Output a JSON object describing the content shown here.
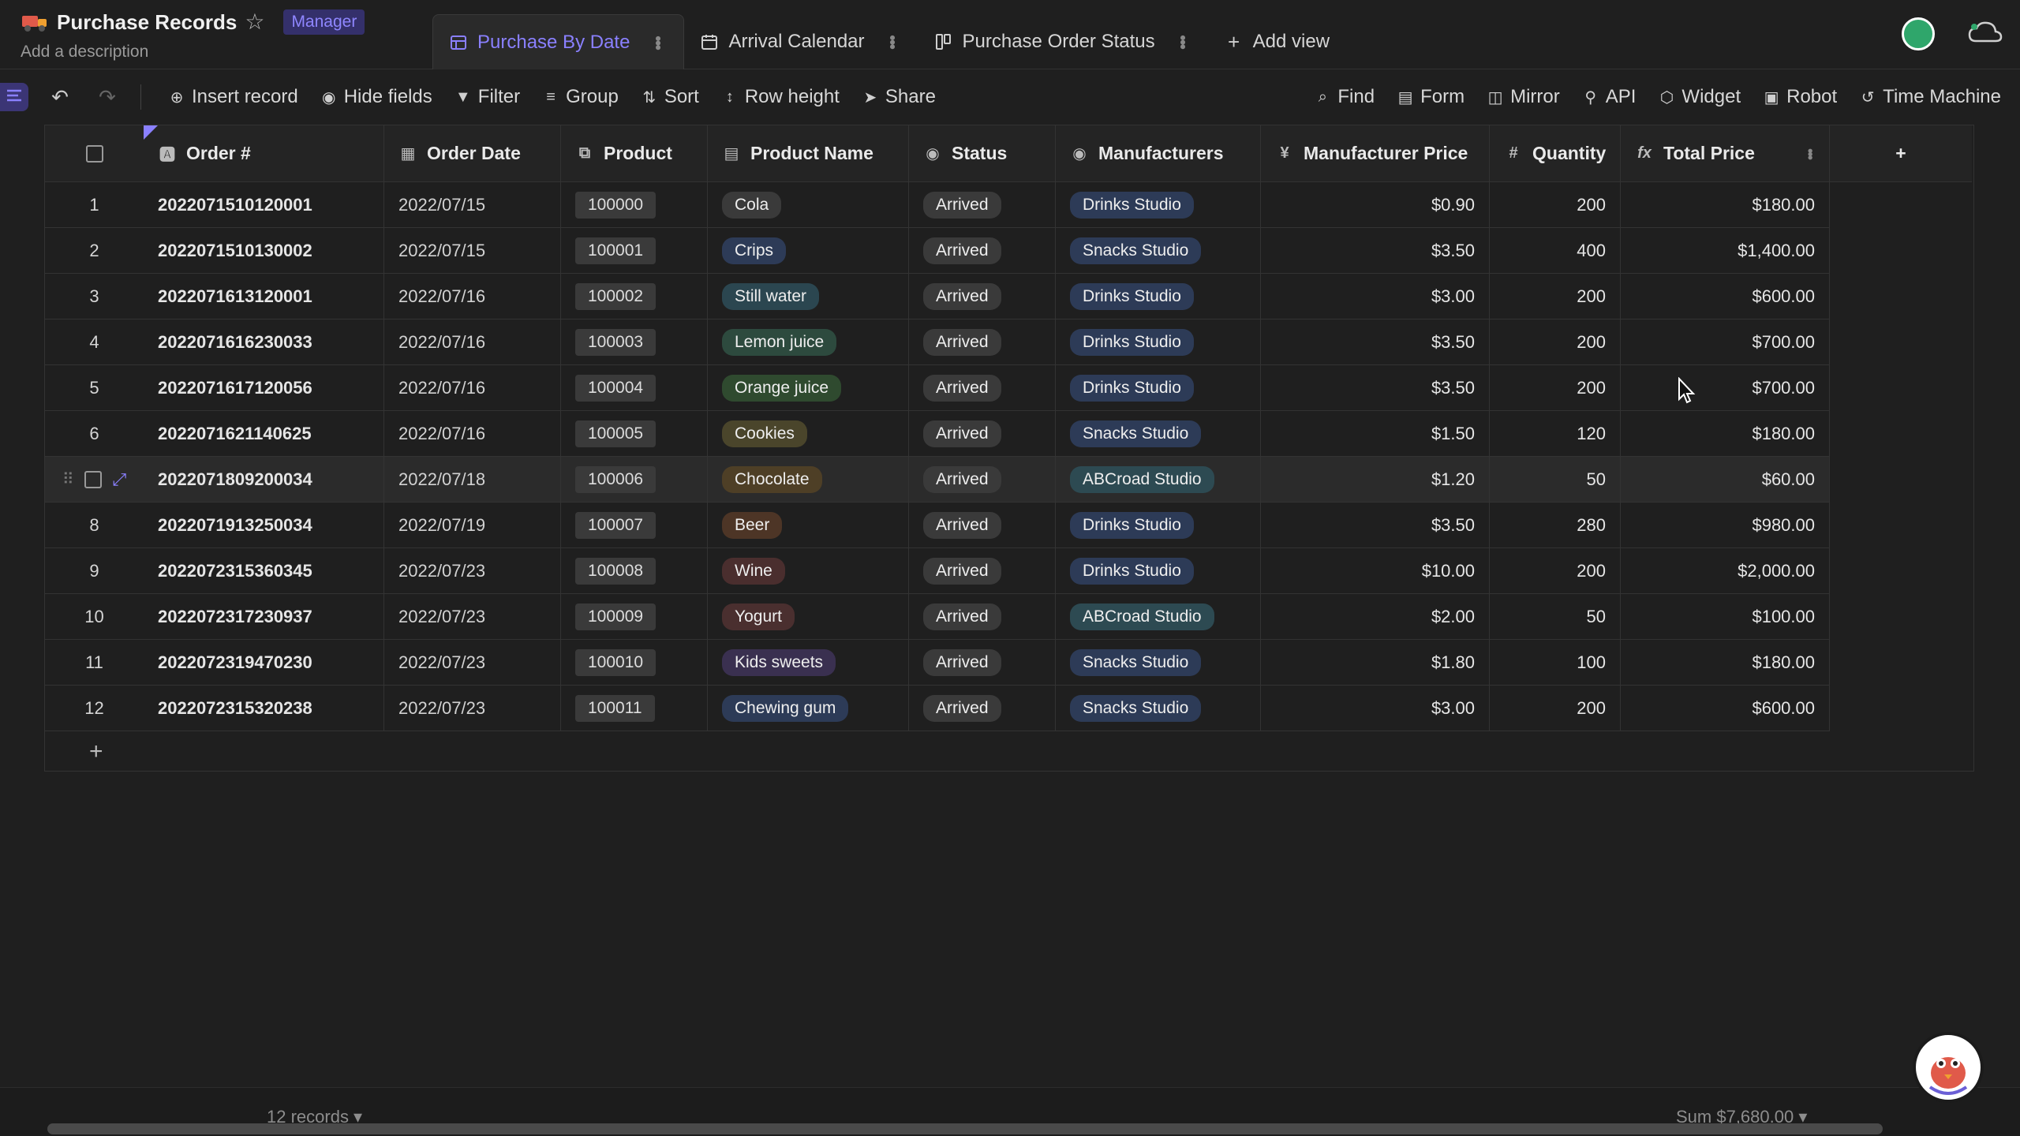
{
  "header": {
    "title": "Purchase Records",
    "role": "Manager",
    "description": "Add a description",
    "tabs": [
      {
        "label": "Purchase By Date",
        "icon": "grid-view-icon",
        "active": true
      },
      {
        "label": "Arrival Calendar",
        "icon": "calendar-icon",
        "active": false
      },
      {
        "label": "Purchase Order Status",
        "icon": "kanban-icon",
        "active": false
      },
      {
        "label": "Add view",
        "icon": "plus-icon",
        "active": false
      }
    ]
  },
  "toolbar": {
    "left": [
      {
        "label": "Insert record",
        "icon": "plus-circle-icon"
      },
      {
        "label": "Hide fields",
        "icon": "eye-icon"
      },
      {
        "label": "Filter",
        "icon": "filter-icon"
      },
      {
        "label": "Group",
        "icon": "group-icon"
      },
      {
        "label": "Sort",
        "icon": "sort-icon"
      },
      {
        "label": "Row height",
        "icon": "row-height-icon"
      },
      {
        "label": "Share",
        "icon": "share-icon"
      }
    ],
    "right": [
      {
        "label": "Find",
        "icon": "search-icon"
      },
      {
        "label": "Form",
        "icon": "form-icon"
      },
      {
        "label": "Mirror",
        "icon": "mirror-icon"
      },
      {
        "label": "API",
        "icon": "api-icon"
      },
      {
        "label": "Widget",
        "icon": "widget-icon"
      },
      {
        "label": "Robot",
        "icon": "robot-icon"
      },
      {
        "label": "Time Machine",
        "icon": "history-icon"
      }
    ]
  },
  "columns": [
    {
      "label": "Order #",
      "icon": "text-field-icon"
    },
    {
      "label": "Order Date",
      "icon": "date-field-icon"
    },
    {
      "label": "Product",
      "icon": "link-field-icon"
    },
    {
      "label": "Product Name",
      "icon": "lookup-field-icon"
    },
    {
      "label": "Status",
      "icon": "select-field-icon"
    },
    {
      "label": "Manufacturers",
      "icon": "select-field-icon"
    },
    {
      "label": "Manufacturer Price",
      "icon": "currency-field-icon"
    },
    {
      "label": "Quantity",
      "icon": "number-field-icon"
    },
    {
      "label": "Total Price",
      "icon": "formula-field-icon"
    }
  ],
  "rows": [
    {
      "idx": "1",
      "order": "2022071510120001",
      "date": "2022/07/15",
      "product": "100000",
      "name": "Cola",
      "status": "Arrived",
      "manufacturer": "Drinks Studio",
      "price": "$0.90",
      "qty": "200",
      "total": "$180.00",
      "name_color": "#3a3a3a"
    },
    {
      "idx": "2",
      "order": "2022071510130002",
      "date": "2022/07/15",
      "product": "100001",
      "name": "Crips",
      "status": "Arrived",
      "manufacturer": "Snacks Studio",
      "price": "$3.50",
      "qty": "400",
      "total": "$1,400.00",
      "name_color": "#2d3b57"
    },
    {
      "idx": "3",
      "order": "2022071613120001",
      "date": "2022/07/16",
      "product": "100002",
      "name": "Still water",
      "status": "Arrived",
      "manufacturer": "Drinks Studio",
      "price": "$3.00",
      "qty": "200",
      "total": "$600.00",
      "name_color": "#2b4650"
    },
    {
      "idx": "4",
      "order": "2022071616230033",
      "date": "2022/07/16",
      "product": "100003",
      "name": "Lemon juice",
      "status": "Arrived",
      "manufacturer": "Drinks Studio",
      "price": "$3.50",
      "qty": "200",
      "total": "$700.00",
      "name_color": "#2d4a3e"
    },
    {
      "idx": "5",
      "order": "2022071617120056",
      "date": "2022/07/16",
      "product": "100004",
      "name": "Orange juice",
      "status": "Arrived",
      "manufacturer": "Drinks Studio",
      "price": "$3.50",
      "qty": "200",
      "total": "$700.00",
      "name_color": "#2f4a2f"
    },
    {
      "idx": "6",
      "order": "2022071621140625",
      "date": "2022/07/16",
      "product": "100005",
      "name": "Cookies",
      "status": "Arrived",
      "manufacturer": "Snacks Studio",
      "price": "$1.50",
      "qty": "120",
      "total": "$180.00",
      "name_color": "#4a452b"
    },
    {
      "idx": "",
      "order": "2022071809200034",
      "date": "2022/07/18",
      "product": "100006",
      "name": "Chocolate",
      "status": "Arrived",
      "manufacturer": "ABCroad Studio",
      "price": "$1.20",
      "qty": "50",
      "total": "$60.00",
      "name_color": "#4e3f26",
      "hover": true
    },
    {
      "idx": "8",
      "order": "2022071913250034",
      "date": "2022/07/19",
      "product": "100007",
      "name": "Beer",
      "status": "Arrived",
      "manufacturer": "Drinks Studio",
      "price": "$3.50",
      "qty": "280",
      "total": "$980.00",
      "name_color": "#4d3526"
    },
    {
      "idx": "9",
      "order": "2022072315360345",
      "date": "2022/07/23",
      "product": "100008",
      "name": "Wine",
      "status": "Arrived",
      "manufacturer": "Drinks Studio",
      "price": "$10.00",
      "qty": "200",
      "total": "$2,000.00",
      "name_color": "#4a2e2e"
    },
    {
      "idx": "10",
      "order": "2022072317230937",
      "date": "2022/07/23",
      "product": "100009",
      "name": "Yogurt",
      "status": "Arrived",
      "manufacturer": "ABCroad Studio",
      "price": "$2.00",
      "qty": "50",
      "total": "$100.00",
      "name_color": "#4a2f2f"
    },
    {
      "idx": "11",
      "order": "2022072319470230",
      "date": "2022/07/23",
      "product": "100010",
      "name": "Kids sweets",
      "status": "Arrived",
      "manufacturer": "Snacks Studio",
      "price": "$1.80",
      "qty": "100",
      "total": "$180.00",
      "name_color": "#3a3050"
    },
    {
      "idx": "12",
      "order": "2022072315320238",
      "date": "2022/07/23",
      "product": "100011",
      "name": "Chewing gum",
      "status": "Arrived",
      "manufacturer": "Snacks Studio",
      "price": "$3.00",
      "qty": "200",
      "total": "$600.00",
      "name_color": "#2d3b57"
    }
  ],
  "footer": {
    "records": "12 records ▾",
    "sum": "Sum $7,680.00 ▾"
  },
  "colors": {
    "accent": "#8a80ff",
    "background": "#1f1f1f"
  }
}
